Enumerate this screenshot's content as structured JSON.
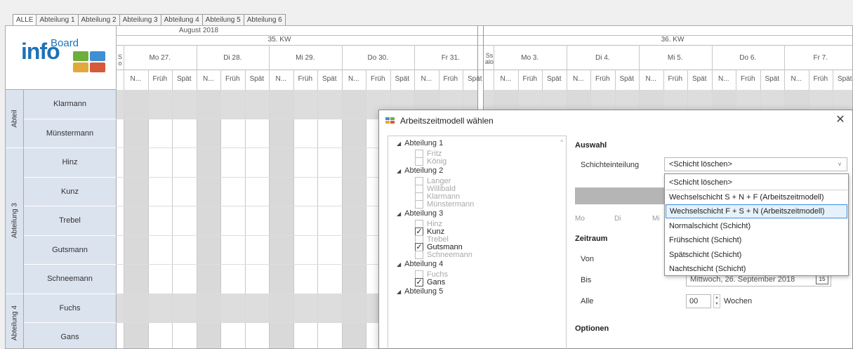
{
  "tabs": [
    "ALLE",
    "Abteilung 1",
    "Abteilung 2",
    "Abteilung 3",
    "Abteilung 4",
    "Abteilung 5",
    "Abteilung 6"
  ],
  "logo": {
    "word1": "info",
    "word2": "Board"
  },
  "schedule": {
    "month": "August 2018",
    "weeks": [
      "35. KW",
      "36. KW"
    ],
    "week35_sep": "S o",
    "week36_sep": "Ss alo",
    "days35": [
      "Mo 27.",
      "Di 28.",
      "Mi 29.",
      "Do 30.",
      "Fr 31."
    ],
    "days36": [
      "Mo 3.",
      "Di 4.",
      "Mi 5.",
      "Do 6.",
      "Fr 7."
    ],
    "shifts": [
      "N...",
      "Früh",
      "Spät"
    ],
    "groups": [
      {
        "label": "Abteil",
        "rows": 2
      },
      {
        "label": "Abteilung 3",
        "rows": 5
      },
      {
        "label": "Abteilung 4",
        "rows": 2
      }
    ],
    "employees": [
      "Klarmann",
      "Münstermann",
      "Hinz",
      "Kunz",
      "Trebel",
      "Gutsmann",
      "Schneemann",
      "Fuchs",
      "Gans"
    ]
  },
  "dialog": {
    "title": "Arbeitszeitmodell wählen",
    "close": "✕",
    "tree": [
      {
        "group": "Abteilung 1",
        "items": [
          {
            "name": "Fritz",
            "checked": false
          },
          {
            "name": "König",
            "checked": false
          }
        ]
      },
      {
        "group": "Abteilung 2",
        "items": [
          {
            "name": "Langer",
            "checked": false
          },
          {
            "name": "Willibald",
            "checked": false
          },
          {
            "name": "Klarmann",
            "checked": false
          },
          {
            "name": "Münstermann",
            "checked": false
          }
        ]
      },
      {
        "group": "Abteilung 3",
        "items": [
          {
            "name": "Hinz",
            "checked": false
          },
          {
            "name": "Kunz",
            "checked": true
          },
          {
            "name": "Trebel",
            "checked": false
          },
          {
            "name": "Gutsmann",
            "checked": true
          },
          {
            "name": "Schneemann",
            "checked": false
          }
        ]
      },
      {
        "group": "Abteilung 4",
        "items": [
          {
            "name": "Fuchs",
            "checked": false
          },
          {
            "name": "Gans",
            "checked": true
          }
        ]
      },
      {
        "group": "Abteilung 5",
        "items": []
      }
    ],
    "auswahl": {
      "title": "Auswahl",
      "schichteinteilung_label": "Schichteinteilung",
      "selected": "<Schicht löschen>",
      "week_labels": [
        "Mo",
        "Di",
        "Mi"
      ]
    },
    "dropdown_options": [
      "<Schicht löschen>",
      "Wechselschicht S + N + F (Arbeitszeitmodell)",
      "Wechselschicht  F + S + N (Arbeitszeitmodell)",
      "Normalschicht (Schicht)",
      "Frühschicht (Schicht)",
      "Spätschicht (Schicht)",
      "Nachtschicht (Schicht)"
    ],
    "highlighted_option_index": 2,
    "zeitraum": {
      "title": "Zeitraum",
      "von_label": "Von",
      "bis_label": "Bis",
      "bis_value": "Mittwoch, 26. September 2018",
      "calendar_day": "15",
      "alle_label": "Alle",
      "alle_value": "00",
      "wochen_label": "Wochen"
    },
    "optionen": {
      "title": "Optionen"
    }
  }
}
